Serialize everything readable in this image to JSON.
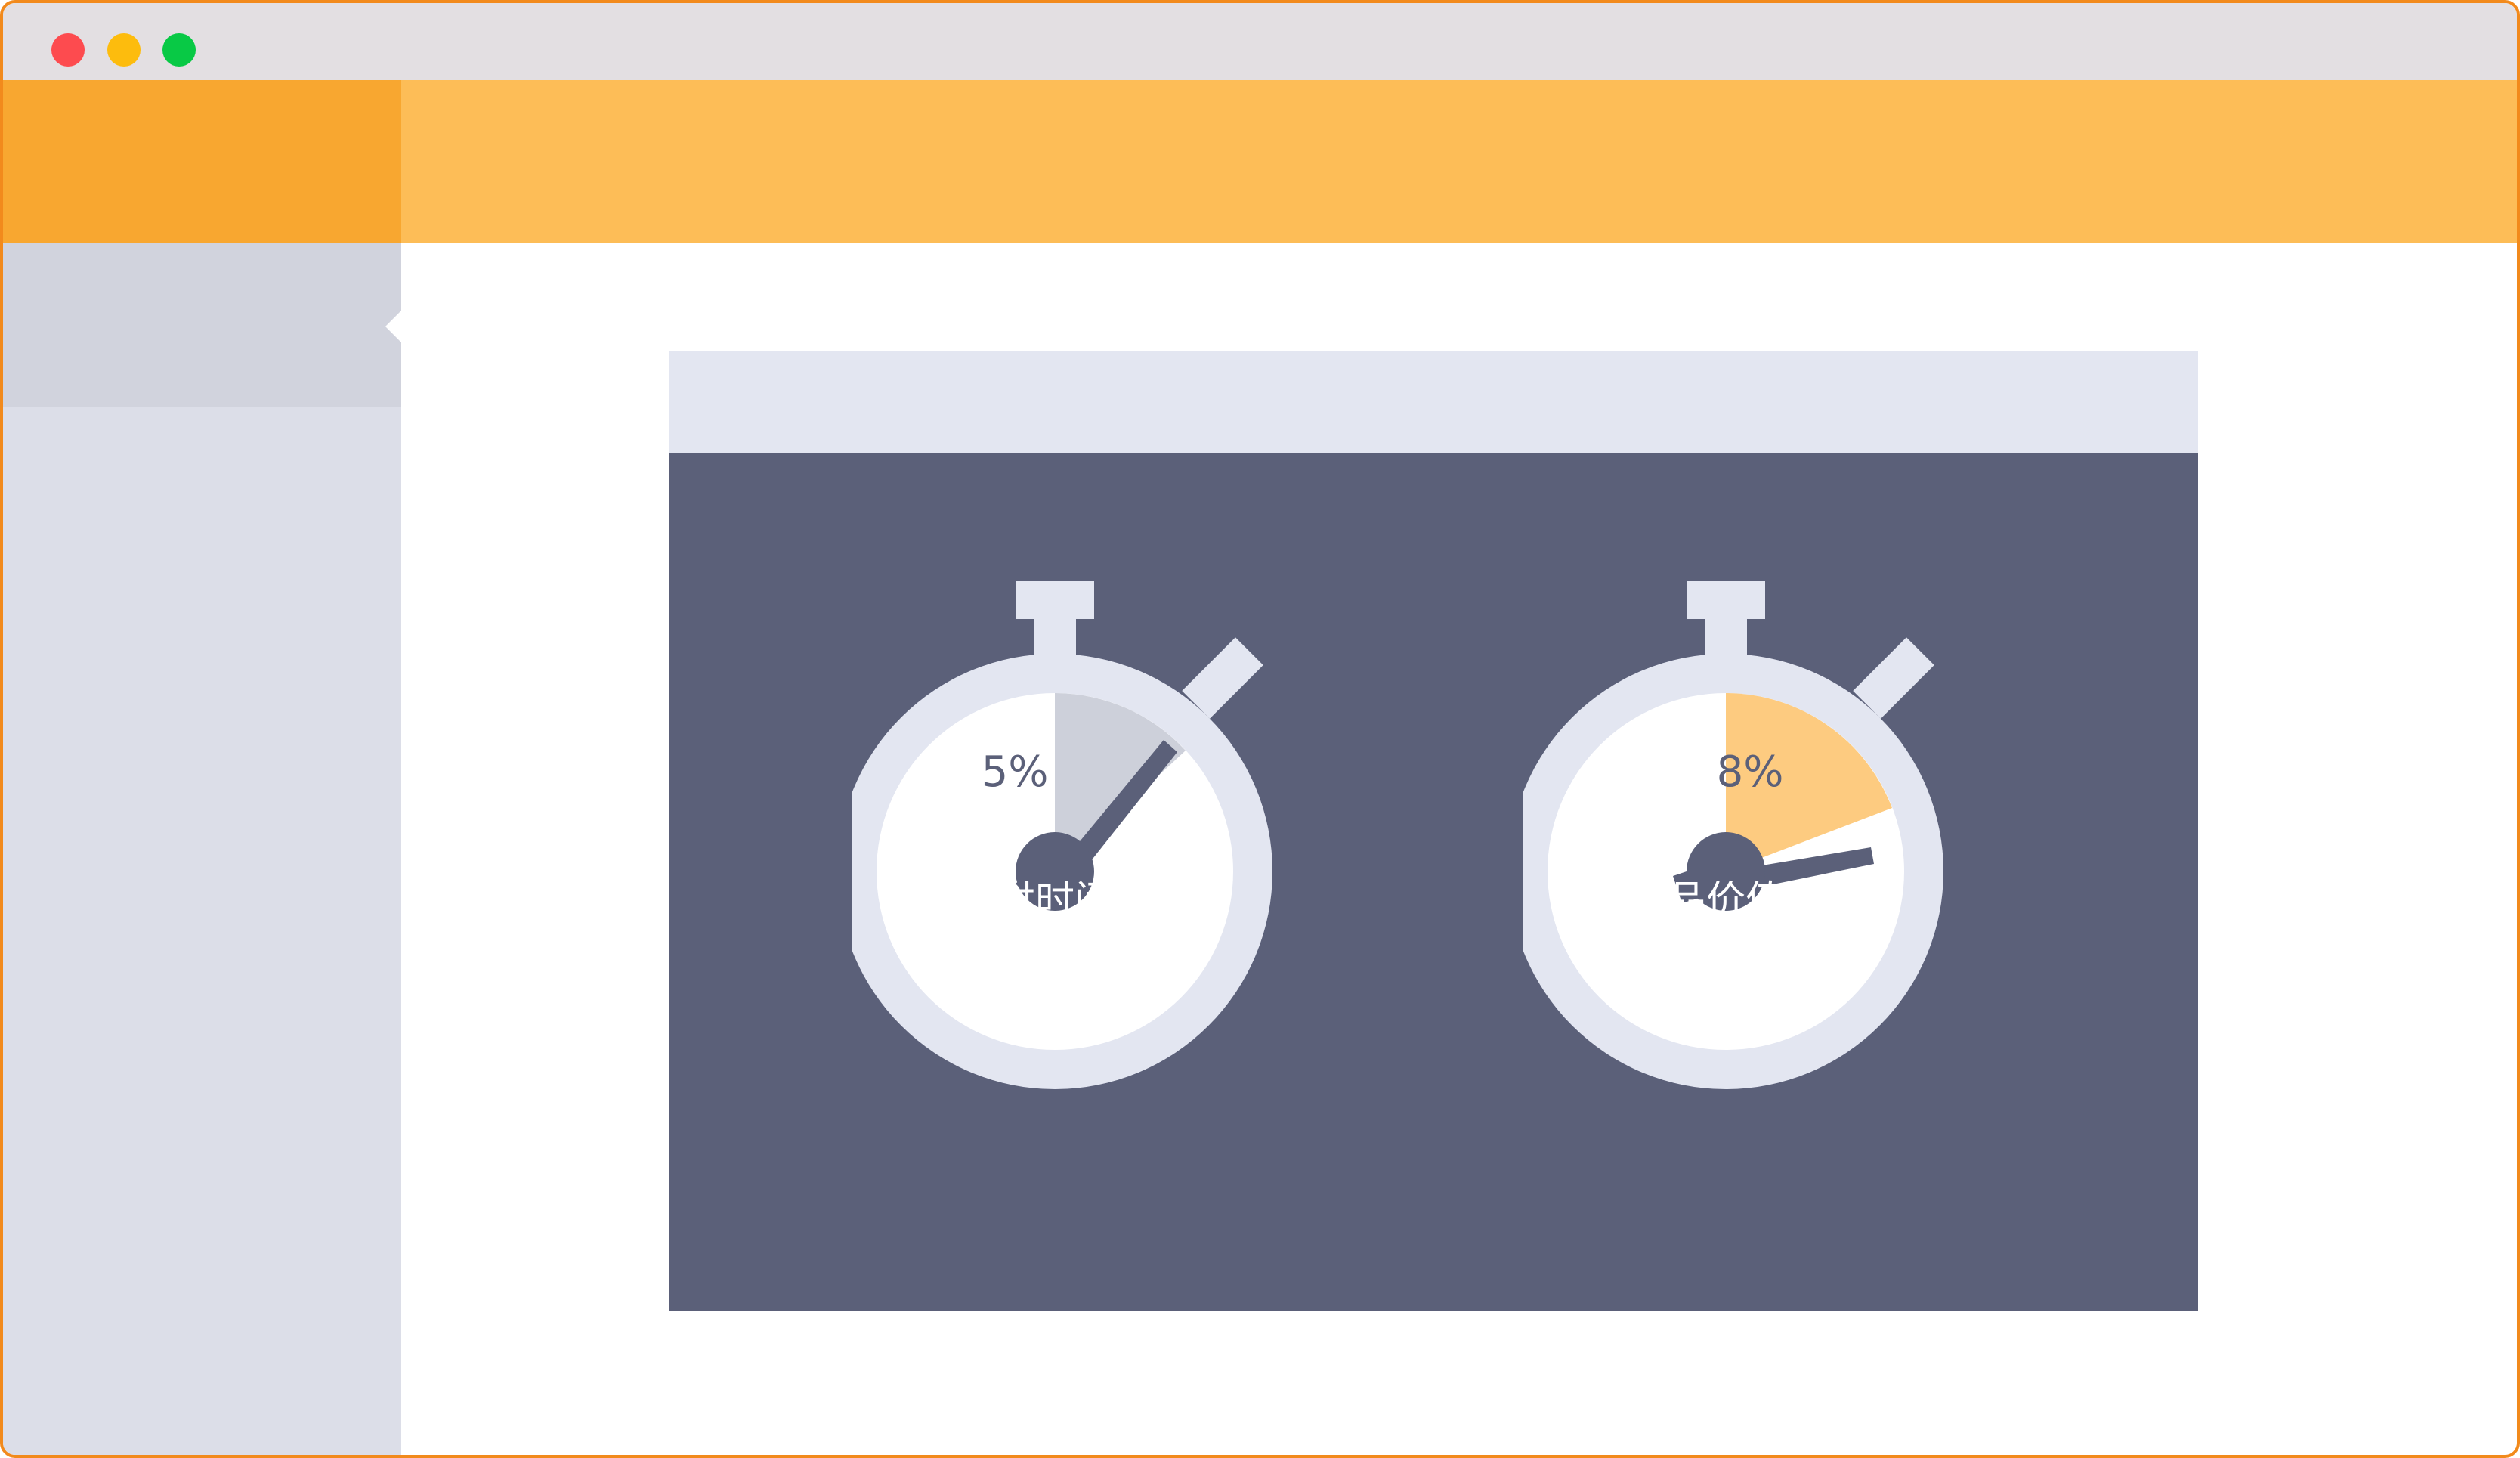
{
  "window": {
    "controls": [
      {
        "name": "close",
        "color": "#fd4b4f"
      },
      {
        "name": "minimize",
        "color": "#fdbc0d"
      },
      {
        "name": "zoom",
        "color": "#08c945"
      }
    ]
  },
  "colors": {
    "header_left": "#f8a730",
    "header_right": "#fdbd57",
    "card_body": "#5b6079",
    "gauge_ring": "#e3e6f1",
    "gauge_fill_gray": "#cdd0da",
    "gauge_fill_orange": "#fdcb80"
  },
  "gauges": [
    {
      "value_text": "5%",
      "label": "交付时间短",
      "fill_color": "#cdd0da",
      "icon": "stopwatch-icon"
    },
    {
      "value_text": "8%",
      "label": "产品价值高",
      "fill_color": "#fdcb80",
      "icon": "stopwatch-icon"
    }
  ]
}
